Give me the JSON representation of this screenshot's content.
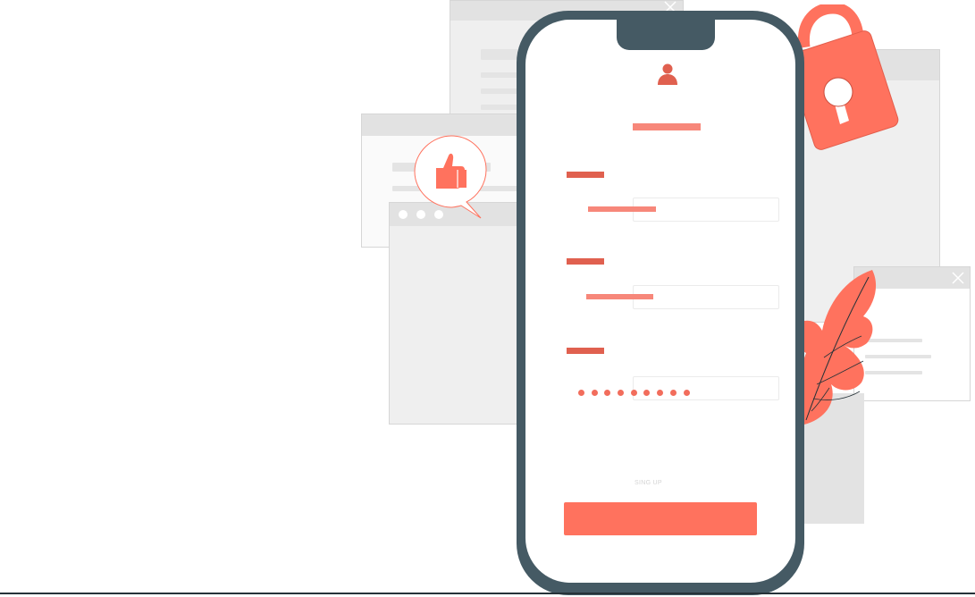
{
  "illustration": {
    "accent_color": "#ff725e",
    "dark_color": "#455a64",
    "background_color": "#ffffff",
    "background_windows": [
      "login-window",
      "like-window",
      "tall-window",
      "lock-window",
      "small-window"
    ],
    "icons": [
      "user-icon",
      "thumbs-up-icon",
      "padlock-icon",
      "leaf-icon",
      "close-icon"
    ]
  },
  "form": {
    "signup_text": "SING UP"
  }
}
